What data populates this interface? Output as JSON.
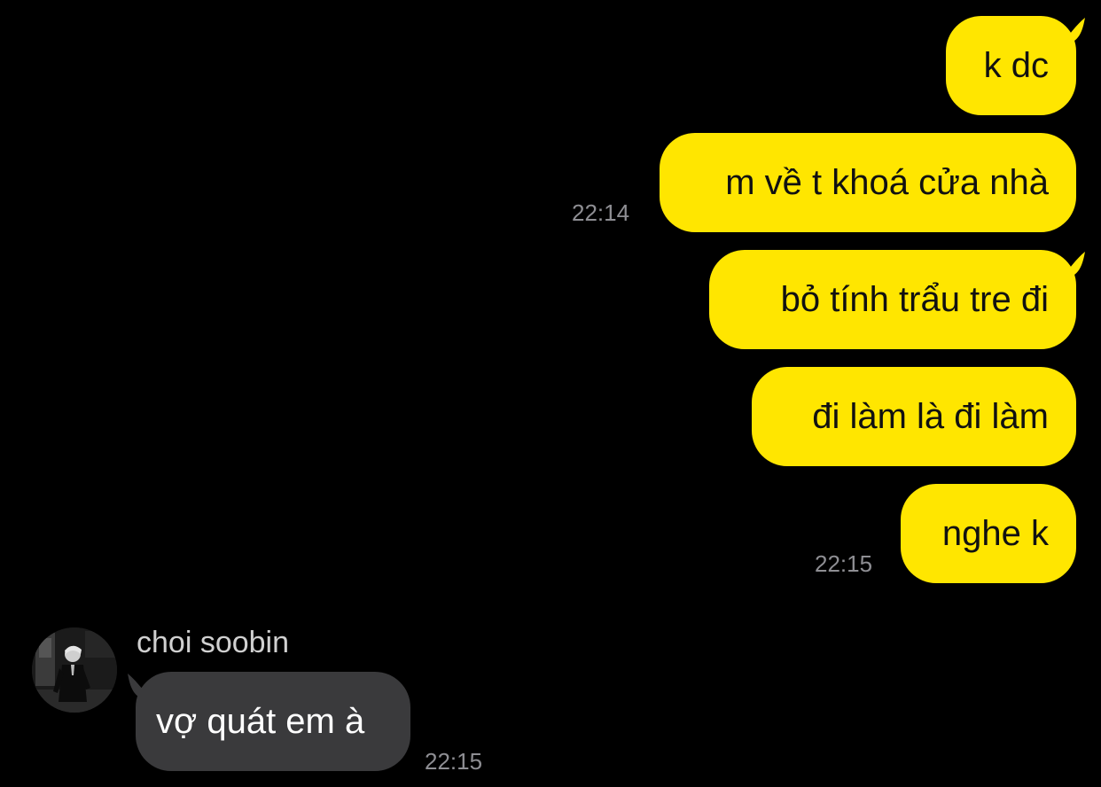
{
  "theme": {
    "outgoing_bubble_color": "#FFE600",
    "incoming_bubble_color": "#3A3A3C",
    "background_color": "#000000",
    "timestamp_color": "#8E8E93"
  },
  "outgoing": [
    {
      "text": "k dc",
      "time": ""
    },
    {
      "text": "m về t khoá cửa nhà",
      "time": "22:14"
    },
    {
      "text": "bỏ tính trẩu tre đi",
      "time": ""
    },
    {
      "text": "đi làm là đi làm",
      "time": ""
    },
    {
      "text": "nghe k",
      "time": "22:15"
    }
  ],
  "incoming": {
    "sender_name": "choi soobin",
    "avatar_icon": "profile-photo-icon",
    "messages": [
      {
        "text": "vợ quát em à",
        "time": "22:15"
      }
    ]
  }
}
